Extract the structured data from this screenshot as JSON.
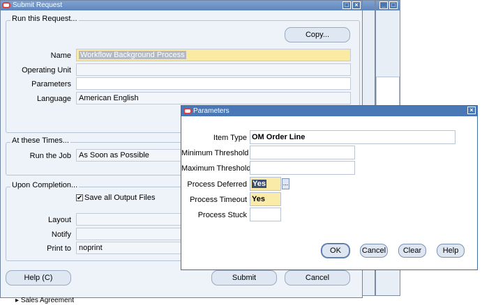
{
  "submit_request": {
    "title": "Submit Request",
    "run_group_label": "Run this Request...",
    "copy_label": "Copy...",
    "name_label": "Name",
    "name_value": "Workflow Background Process",
    "operating_unit_label": "Operating Unit",
    "parameters_label": "Parameters",
    "language_label": "Language",
    "language_value": "American English",
    "times_group_label": "At these Times...",
    "run_job_label": "Run the Job",
    "run_job_value": "As Soon as Possible",
    "completion_group_label": "Upon Completion...",
    "save_output_label": "Save all Output Files",
    "save_output_checked": true,
    "layout_label": "Layout",
    "notify_label": "Notify",
    "print_to_label": "Print to",
    "print_to_value": "noprint",
    "help_label": "Help (C)",
    "submit_label": "Submit",
    "cancel_label": "Cancel"
  },
  "background_text": "Sales Agreement",
  "parameters_dialog": {
    "title": "Parameters",
    "fields": {
      "item_type": {
        "label": "Item Type",
        "value": "OM Order Line"
      },
      "minimum_threshold": {
        "label": "Minimum Threshold",
        "value": ""
      },
      "maximum_threshold": {
        "label": "Maximum Threshold",
        "value": ""
      },
      "process_deferred": {
        "label": "Process Deferred",
        "value": "Yes"
      },
      "process_timeout": {
        "label": "Process Timeout",
        "value": "Yes"
      },
      "process_stuck": {
        "label": "Process Stuck",
        "value": ""
      }
    },
    "lov_label": "...",
    "ok_label": "OK",
    "cancel_label": "Cancel",
    "clear_label": "Clear",
    "help_label": "Help"
  },
  "colors": {
    "title_bar": "#4a78b7",
    "required_field": "#fbeba8",
    "oracle_icon": "#e23b3b"
  }
}
